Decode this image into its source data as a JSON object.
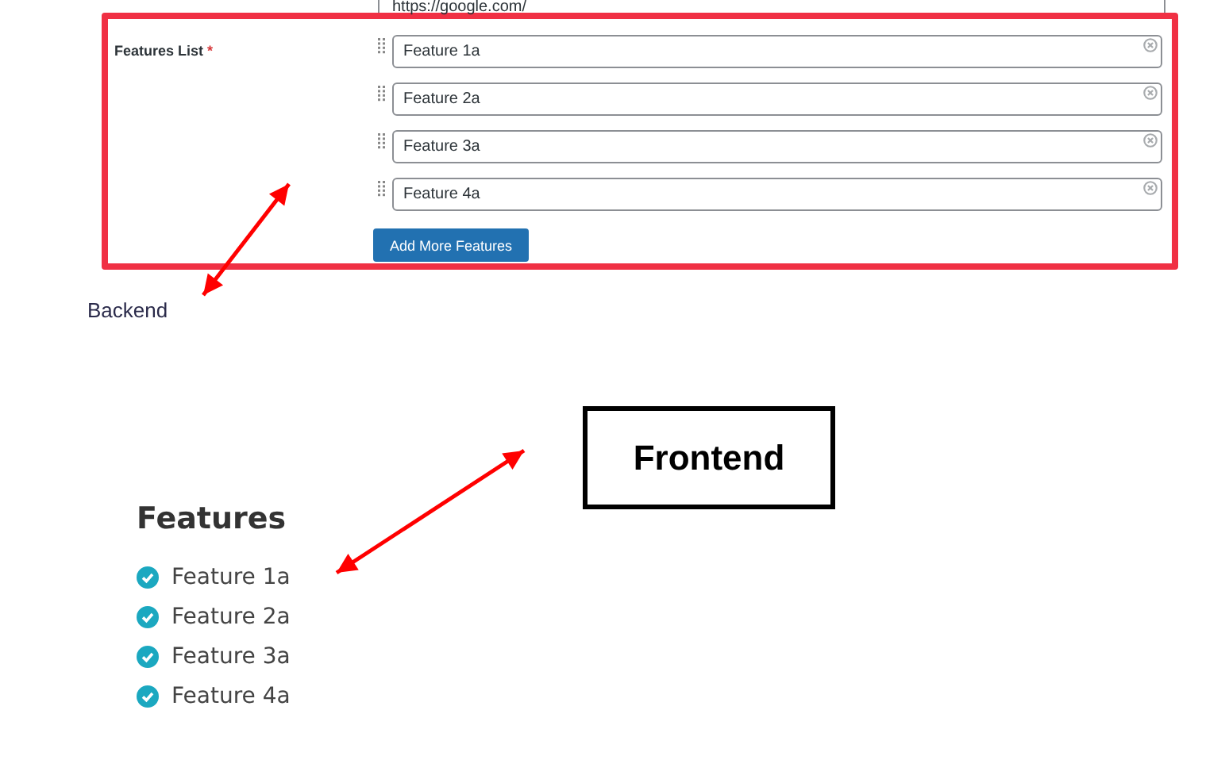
{
  "url_field": {
    "value": "https://google.com/"
  },
  "features_field": {
    "label": "Features List",
    "required_mark": "*",
    "items": [
      {
        "value": "Feature 1a"
      },
      {
        "value": "Feature 2a"
      },
      {
        "value": "Feature 3a"
      },
      {
        "value": "Feature 4a"
      }
    ],
    "add_button": "Add More Features"
  },
  "backend_label": "Backend",
  "frontend_label": "Frontend",
  "frontend": {
    "title": "Features",
    "items": [
      {
        "label": "Feature 1a",
        "checked": true
      },
      {
        "label": "Feature 2a",
        "checked": true
      },
      {
        "label": "Feature 3a",
        "checked": true
      },
      {
        "label": "Feature 4a",
        "checked": true
      }
    ]
  }
}
